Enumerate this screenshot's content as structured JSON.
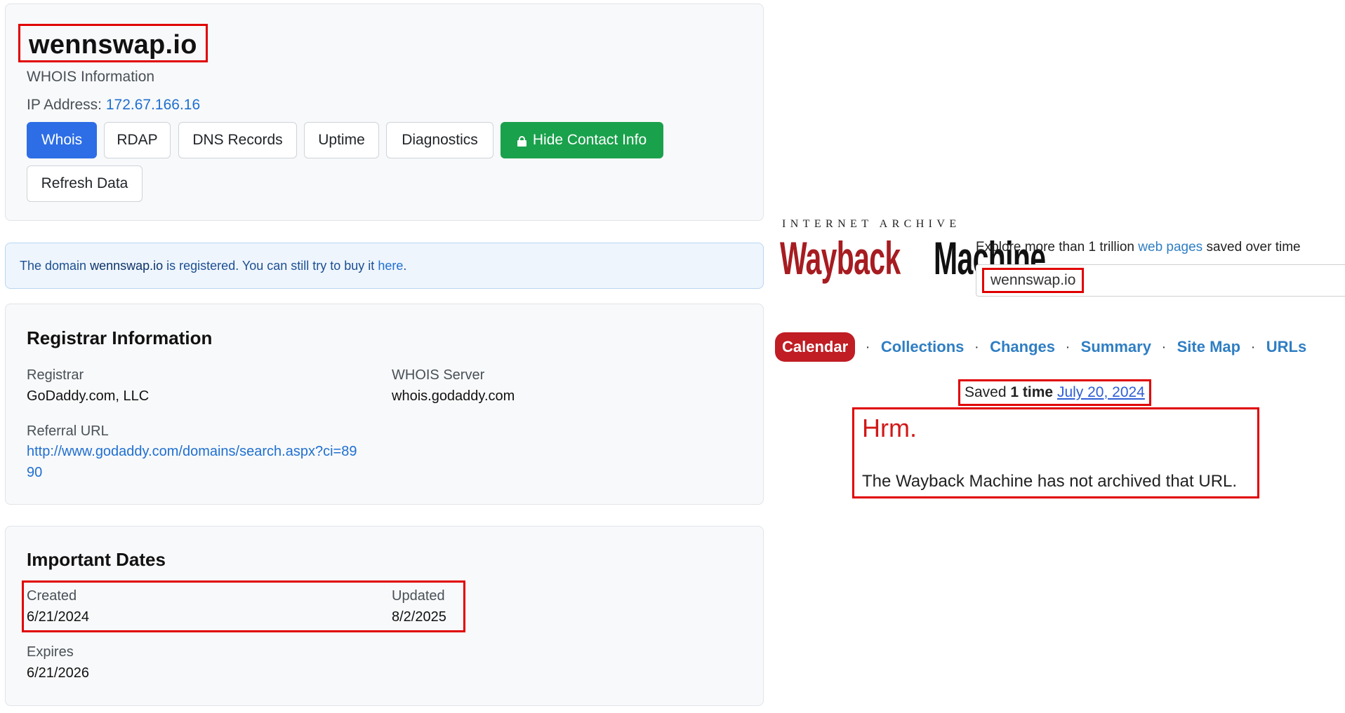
{
  "whois": {
    "domain": "wennswap.io",
    "subtitle": "WHOIS Information",
    "ip_label": "IP Address:",
    "ip_value": "172.67.166.16",
    "buttons": {
      "whois": "Whois",
      "rdap": "RDAP",
      "dns": "DNS Records",
      "uptime": "Uptime",
      "diagnostics": "Diagnostics",
      "hide_contact": "Hide Contact Info",
      "refresh": "Refresh Data"
    },
    "alert": {
      "prefix": "The domain",
      "domain": "wennswap.io",
      "middle": "is registered. You can still try to buy it",
      "link": "here",
      "suffix": "."
    },
    "registrar": {
      "title": "Registrar Information",
      "registrar_label": "Registrar",
      "registrar_value": "GoDaddy.com, LLC",
      "server_label": "WHOIS Server",
      "server_value": "whois.godaddy.com",
      "referral_label": "Referral URL",
      "referral_value": "http://www.godaddy.com/domains/search.aspx?ci=8990"
    },
    "dates": {
      "title": "Important Dates",
      "created_label": "Created",
      "created_value": "6/21/2024",
      "updated_label": "Updated",
      "updated_value": "8/2/2025",
      "expires_label": "Expires",
      "expires_value": "6/21/2026"
    }
  },
  "wayback": {
    "archive_label": "INTERNET ARCHIVE",
    "logo_red": "Wayback",
    "logo_black": "Machine",
    "explore_prefix": "Explore more than 1 trillion",
    "explore_link": "web pages",
    "explore_suffix": "saved over time",
    "search_value": "wennswap.io",
    "tabs": [
      "Calendar",
      "Collections",
      "Changes",
      "Summary",
      "Site Map",
      "URLs"
    ],
    "saved_prefix": "Saved",
    "saved_count": "1 time",
    "saved_date": "July 20, 2024",
    "hrm_title": "Hrm.",
    "hrm_message": "The Wayback Machine has not archived that URL."
  },
  "colors": {
    "primary": "#2d6ee6",
    "success": "#1aa14c",
    "link": "#1f6fd1",
    "highlight": "#e00000",
    "wayback_red": "#c01d24"
  }
}
